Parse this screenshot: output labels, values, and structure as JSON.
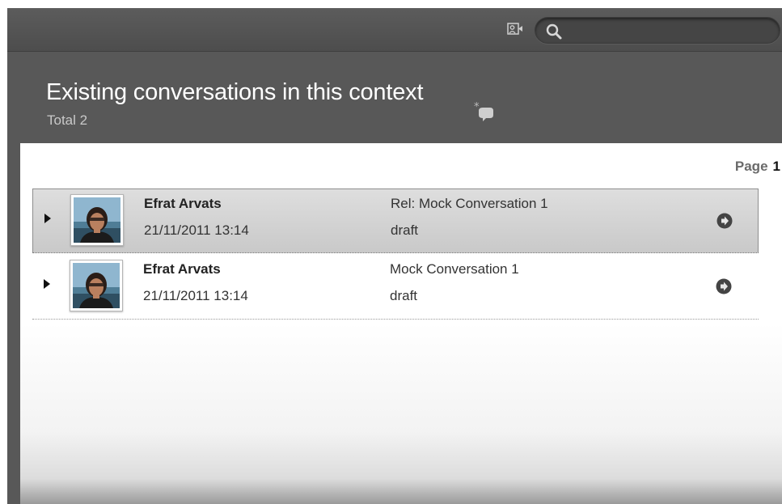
{
  "toolbar": {
    "search_placeholder": "",
    "video_icon": "video-call-icon",
    "search_icon": "search-icon"
  },
  "header": {
    "title": "Existing conversations in this context",
    "total": "Total 2",
    "new_icon": "new-conversation-icon"
  },
  "pager": {
    "label": "Page",
    "current": "1"
  },
  "conversations": [
    {
      "author": "Efrat Arvats",
      "date": "21/11/2011 13:14",
      "subject": "Rel: Mock Conversation 1",
      "status": "draft",
      "selected": true
    },
    {
      "author": "Efrat Arvats",
      "date": "21/11/2011 13:14",
      "subject": "Mock Conversation 1",
      "status": "draft",
      "selected": false
    }
  ],
  "colors": {
    "chrome": "#585858",
    "toolbar": "#4d4d4d",
    "selected_row": "#d0d0d0"
  }
}
